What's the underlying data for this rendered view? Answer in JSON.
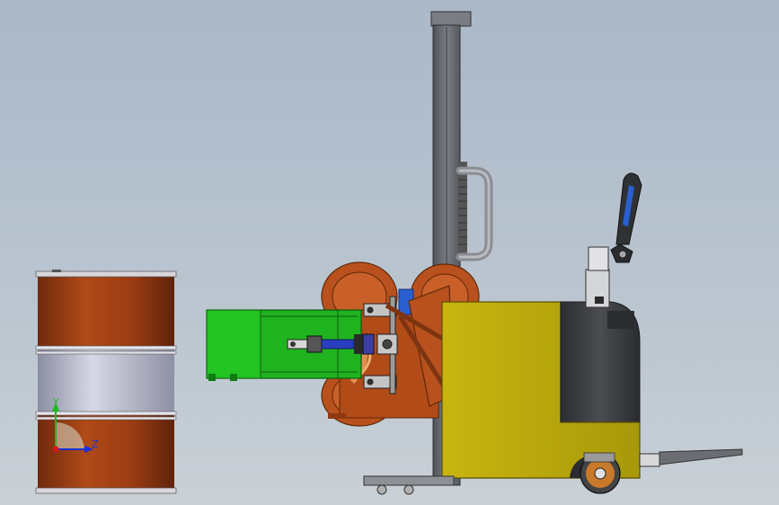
{
  "triad": {
    "y_label": "Y",
    "z_label": "Z",
    "y_color": "#1fb81f",
    "z_color": "#1a2fd6",
    "x_color": "#d11a1a"
  },
  "colors": {
    "background_top": "#aab8c8",
    "drum_rust": "#9a3b12",
    "drum_band": "#aeb0c2",
    "mast": "#6b6e73",
    "body_yellow": "#b9a80a",
    "clamp_green": "#1fb31f",
    "rotator_orange": "#b8511d",
    "cylinder_blue": "#2a3fbf",
    "handle_blue": "#2a5fd0"
  }
}
